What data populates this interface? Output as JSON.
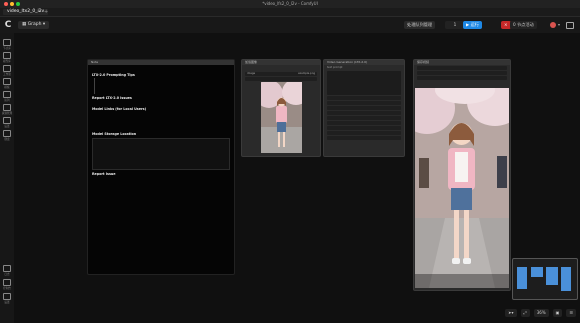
{
  "window": {
    "title": "*video_lfs2_0_l2v - ComfyUI"
  },
  "tabs": [
    {
      "label": "video_ltx2_0_i2v",
      "close": "×"
    }
  ],
  "new_tab": "+",
  "toolbar": {
    "graph_label": "Graph",
    "queue_manage": "处理队列管理",
    "batch_count": "1",
    "run_label": "运行",
    "stop_label": "×",
    "active_label": "0 节点活动"
  },
  "sidebar": {
    "items": [
      {
        "label": "节点库",
        "icon": "node-library-icon"
      },
      {
        "label": "模型库",
        "icon": "model-library-icon"
      },
      {
        "label": "工作流",
        "icon": "workflow-icon"
      },
      {
        "label": "模板",
        "icon": "template-icon"
      },
      {
        "label": "队列",
        "icon": "queue-icon"
      },
      {
        "label": "资源管理",
        "icon": "assets-icon"
      },
      {
        "label": "设置",
        "icon": "settings-icon"
      },
      {
        "label": "键盘",
        "icon": "keyboard-icon"
      }
    ],
    "bottom_items": [
      {
        "label": "日志",
        "icon": "logs-icon"
      },
      {
        "label": "控制台",
        "icon": "console-icon"
      },
      {
        "label": "设置",
        "icon": "gear-icon"
      }
    ]
  },
  "note_node": {
    "title": "Note",
    "heading1": "LTX-2.0 Prompting Tips",
    "heading2": "Report LTX-2.0 Issues",
    "heading3": "Model Links (for Local Users)",
    "heading4": "Model Storage Location",
    "heading5": "Report Issue"
  },
  "load_image_node": {
    "title": "加载图像",
    "image_label": "image",
    "filename": "example.png"
  },
  "prompt_node": {
    "title": "Video Generation (LTX-2.0)",
    "subtitle": "text prompt"
  },
  "preview_node": {
    "title": "保存视频"
  },
  "bottom": {
    "zoom": "36%"
  },
  "colors": {
    "accent": "#1e88e5",
    "stop": "#c62828",
    "canvas": "#101010"
  }
}
